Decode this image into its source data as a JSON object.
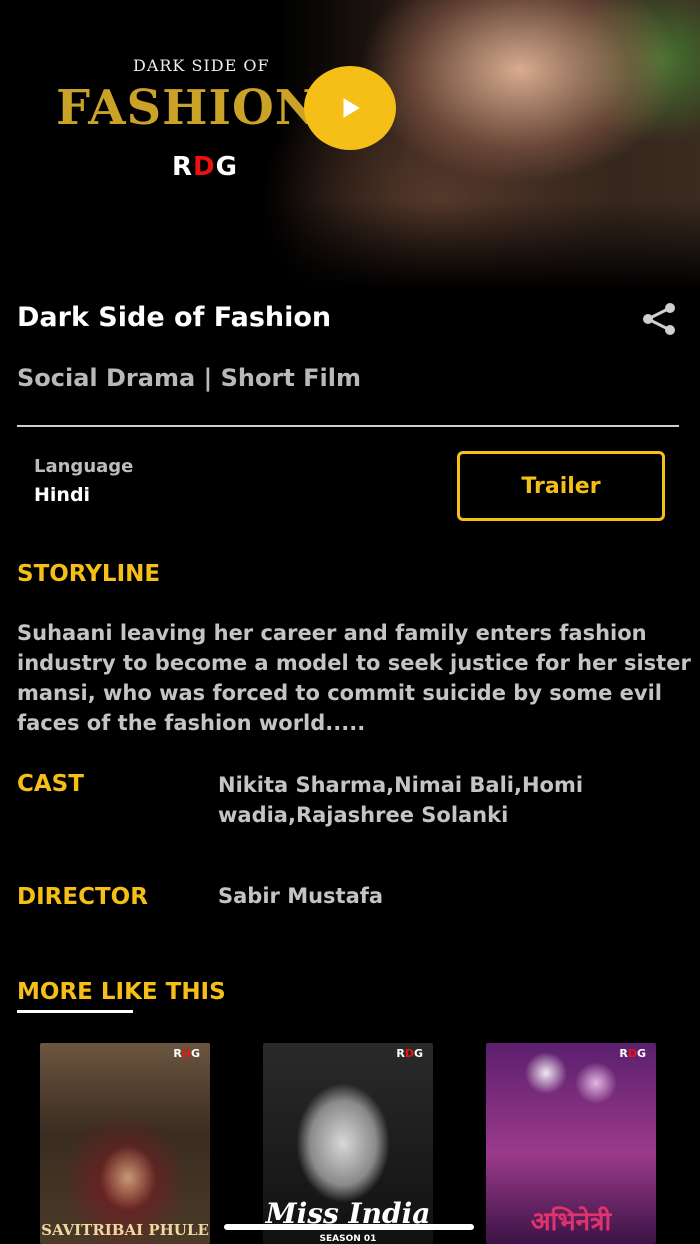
{
  "hero": {
    "poster_small": "DARK SIDE OF",
    "poster_big": "FASHION",
    "logo_r": "R",
    "logo_d": "D",
    "logo_g": "G",
    "play_icon": "play-icon"
  },
  "details": {
    "title": "Dark Side of Fashion",
    "share_icon": "share-icon",
    "genre": "Social Drama | Short Film",
    "language_label": "Language",
    "language_value": "Hindi",
    "trailer_label": "Trailer"
  },
  "storyline": {
    "heading": "STORYLINE",
    "text": "Suhaani leaving her career  and family enters fashion industry to become a model to seek justice for her sister mansi, who was forced to commit suicide by some evil faces of the fashion world....."
  },
  "cast": {
    "heading": "CAST",
    "value": "Nikita Sharma,Nimai Bali,Homi wadia,Rajashree Solanki"
  },
  "director": {
    "heading": "DIRECTOR",
    "value": "Sabir Mustafa"
  },
  "more_like_this": {
    "heading": "MORE LIKE THIS",
    "items": [
      {
        "title": "SAVITRIBAI PHULE",
        "badge_r": "R",
        "badge_d": "D",
        "badge_g": "G"
      },
      {
        "title": "Miss India",
        "subtitle": "SEASON 01",
        "badge_r": "R",
        "badge_d": "D",
        "badge_g": "G"
      },
      {
        "title": "अभिनेत्री",
        "badge_r": "R",
        "badge_d": "D",
        "badge_g": "G"
      }
    ]
  },
  "colors": {
    "accent": "#f5bf17",
    "background": "#000000",
    "muted_text": "#c4c4c4"
  }
}
